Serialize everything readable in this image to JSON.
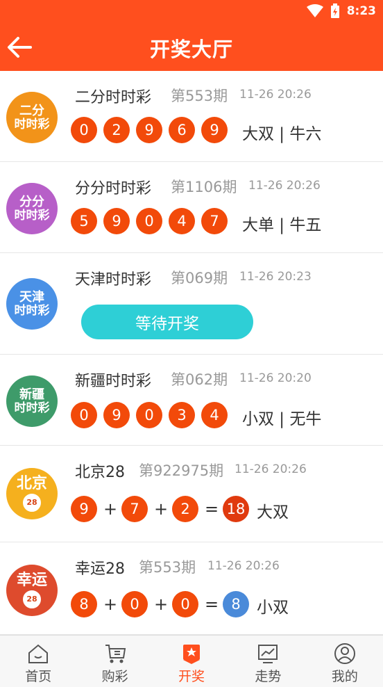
{
  "status": {
    "time": "8:23"
  },
  "header": {
    "title": "开奖大厅"
  },
  "colors": {
    "accent": "#ff4f1e",
    "ball": "#f24a0a",
    "wait": "#2ecfd6"
  },
  "rows": [
    {
      "name": "二分时时彩",
      "issue": "第553期",
      "time": "11-26 20:26",
      "logo": {
        "line1": "二分",
        "line2": "时时彩",
        "color": "#f29319"
      },
      "balls": [
        "0",
        "2",
        "9",
        "6",
        "9"
      ],
      "result": "大双 | 牛六"
    },
    {
      "name": "分分时时彩",
      "issue": "第1106期",
      "time": "11-26 20:26",
      "logo": {
        "line1": "分分",
        "line2": "时时彩",
        "color": "#b75fc8"
      },
      "balls": [
        "5",
        "9",
        "0",
        "4",
        "7"
      ],
      "result": "大单 | 牛五"
    },
    {
      "name": "天津时时彩",
      "issue": "第069期",
      "time": "11-26 20:23",
      "logo": {
        "line1": "天津",
        "line2": "时时彩",
        "color": "#4a91e6"
      },
      "wait_label": "等待开奖"
    },
    {
      "name": "新疆时时彩",
      "issue": "第062期",
      "time": "11-26 20:20",
      "logo": {
        "line1": "新疆",
        "line2": "时时彩",
        "color": "#3e9b6a"
      },
      "balls": [
        "0",
        "9",
        "0",
        "3",
        "4"
      ],
      "result": "小双 | 无牛"
    },
    {
      "name": "北京28",
      "issue": "第922975期",
      "time": "11-26 20:26",
      "logo": {
        "line1": "北京",
        "line2": "28",
        "color": "#f5b01e"
      },
      "nums": [
        "9",
        "7",
        "2"
      ],
      "sum": "18",
      "result": "大双"
    },
    {
      "name": "幸运28",
      "issue": "第553期",
      "time": "11-26 20:26",
      "logo": {
        "line1": "幸运",
        "line2": "28",
        "color": "#de4b2d"
      },
      "nums": [
        "8",
        "0",
        "0"
      ],
      "sum": "8",
      "result": "小双"
    }
  ],
  "nav": [
    {
      "label": "首页",
      "icon": "home-icon"
    },
    {
      "label": "购彩",
      "icon": "cart-icon"
    },
    {
      "label": "开奖",
      "icon": "draw-icon",
      "active": true
    },
    {
      "label": "走势",
      "icon": "trend-icon"
    },
    {
      "label": "我的",
      "icon": "user-icon"
    }
  ]
}
